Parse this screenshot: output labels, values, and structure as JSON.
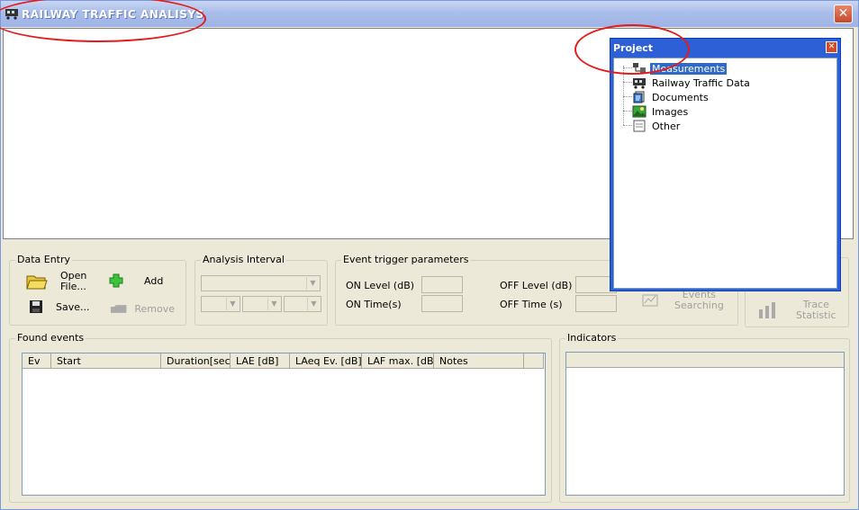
{
  "window": {
    "title": "RAILWAY TRAFFIC ANALISYS",
    "close_glyph": "✕"
  },
  "project": {
    "title": "Project",
    "close_glyph": "✕",
    "items": [
      {
        "label": "Measurements",
        "icon": "measurements-icon",
        "selected": true
      },
      {
        "label": "Railway Traffic Data",
        "icon": "train-icon",
        "selected": false
      },
      {
        "label": "Documents",
        "icon": "documents-icon",
        "selected": false
      },
      {
        "label": "Images",
        "icon": "images-icon",
        "selected": false
      },
      {
        "label": "Other",
        "icon": "other-icon",
        "selected": false
      }
    ]
  },
  "data_entry": {
    "label": "Data Entry",
    "open_label_1": "Open",
    "open_label_2": "File...",
    "add_label": "Add",
    "save_label": "Save...",
    "remove_label": "Remove"
  },
  "analysis_interval": {
    "label": "Analysis Interval"
  },
  "event_trigger": {
    "label": "Event trigger parameters",
    "on_level": "ON Level (dB)",
    "on_time": "ON Time(s)",
    "off_level": "OFF Level (dB)",
    "off_time": "OFF Time (s)",
    "events_searching_1": "Events",
    "events_searching_2": "Searching"
  },
  "trace_statistic": {
    "line1": "Trace",
    "line2": "Statistic"
  },
  "found_events": {
    "label": "Found events",
    "columns": [
      "Ev",
      "Start",
      "Duration[sec]",
      "LAE [dB]",
      "LAeq Ev. [dB]",
      "LAF max. [dB]",
      "Notes"
    ]
  },
  "indicators": {
    "label": "Indicators"
  },
  "colors": {
    "annotation": "#e31b1b",
    "selection": "#316ac5",
    "panel_blue": "#2d5fd6"
  }
}
